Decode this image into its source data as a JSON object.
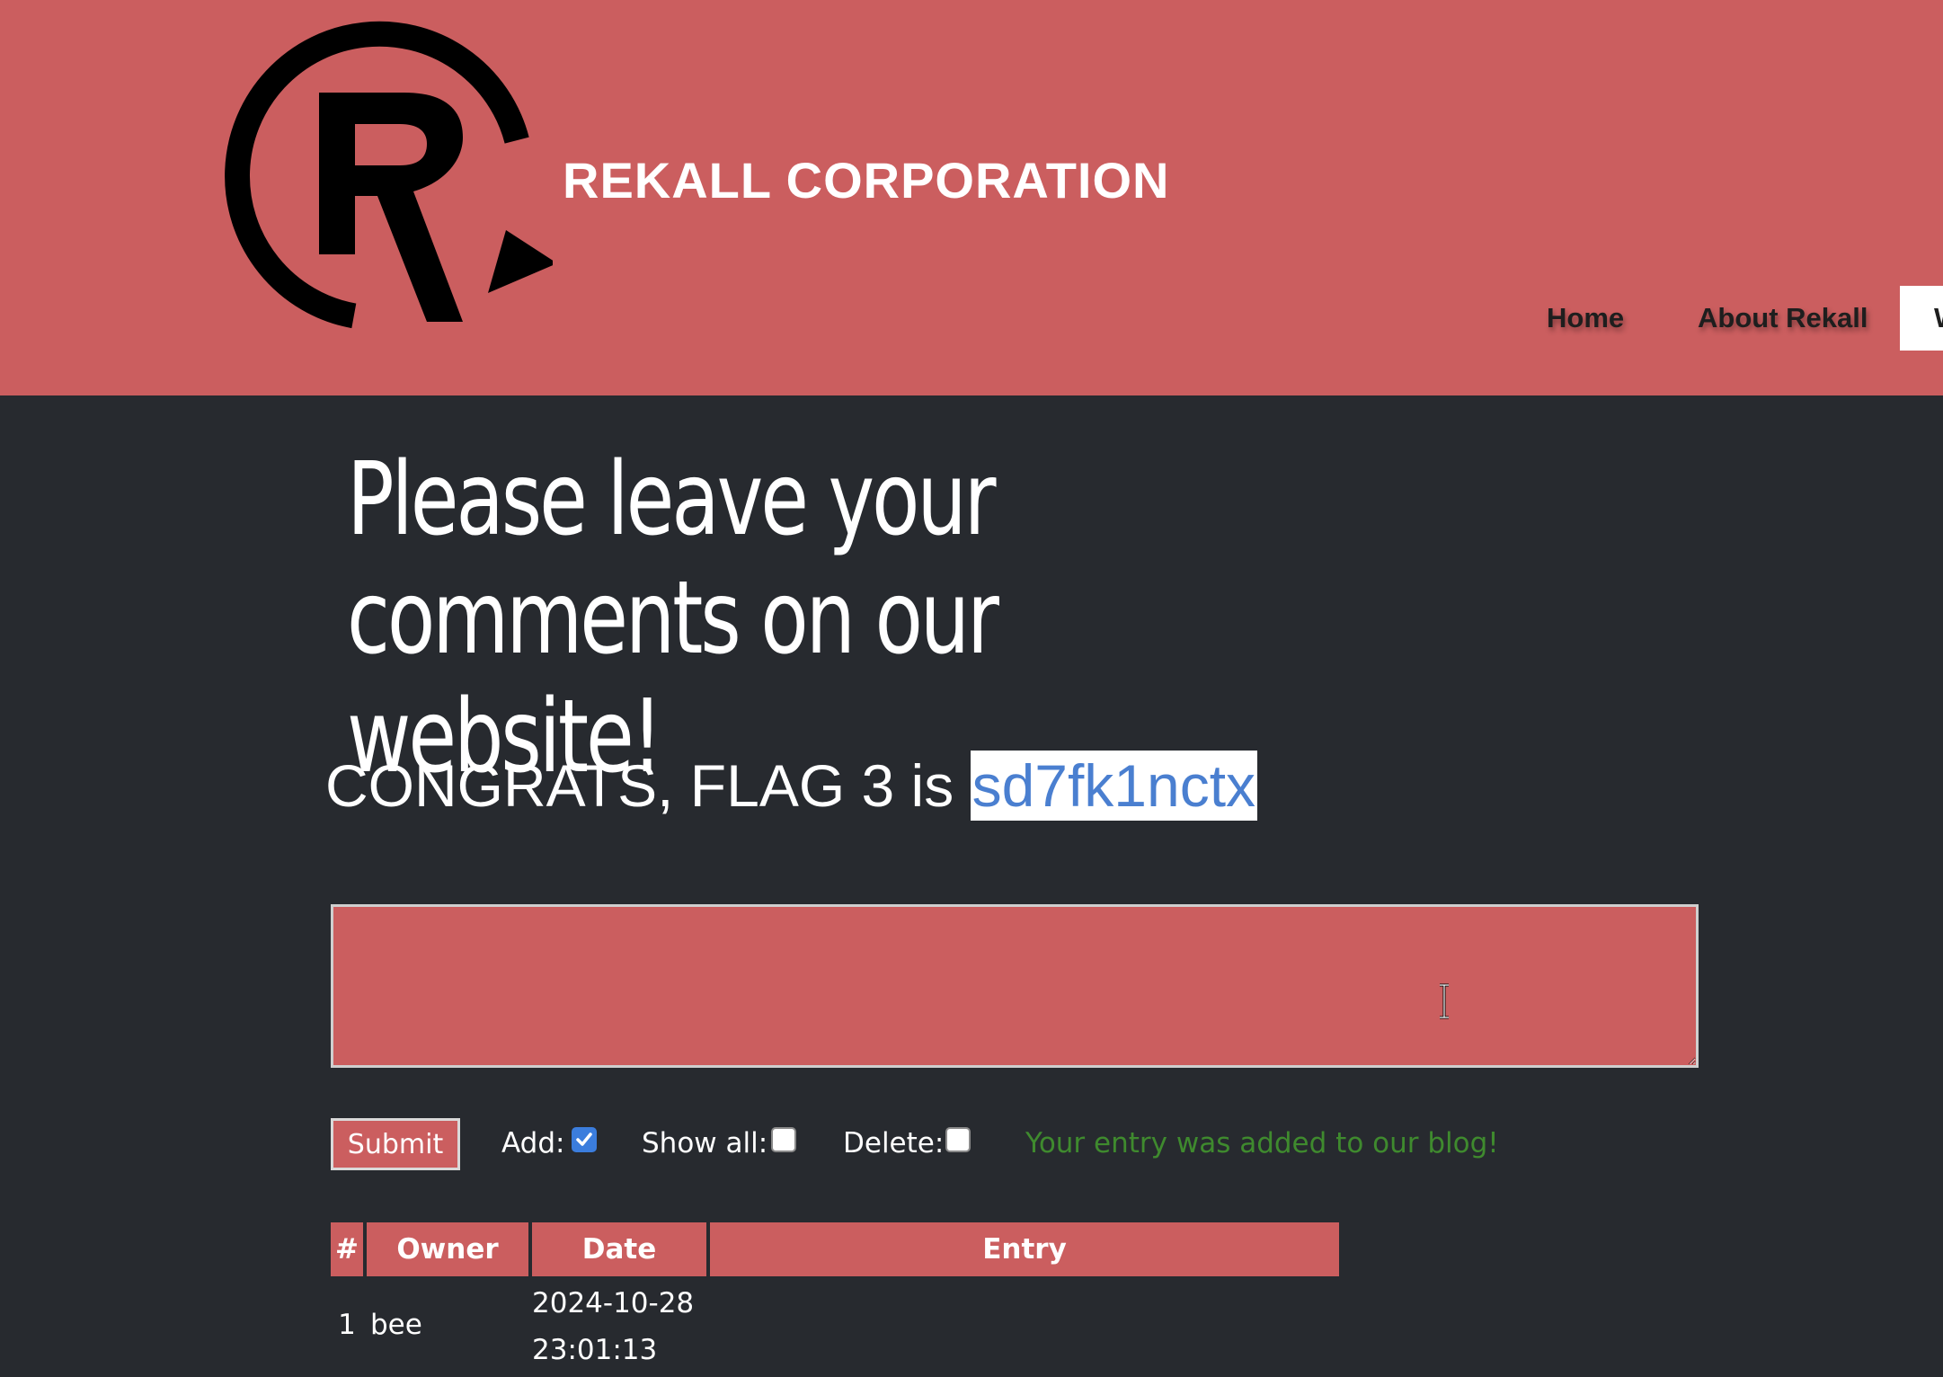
{
  "header": {
    "brand": "REKALL CORPORATION",
    "logo_icon": "rekall-logo-icon",
    "nav": {
      "home": "Home",
      "about": "About Rekall",
      "active_partial": "W"
    },
    "background_color": "#cb5e5f"
  },
  "main": {
    "title": "Please leave your comments on our website!",
    "flag": {
      "prefix": "CONGRATS, FLAG 3 is ",
      "value": "sd7fk1nctx"
    },
    "comment_value": "",
    "controls": {
      "submit_label": "Submit",
      "add_label": "Add:",
      "add_checked": true,
      "show_all_label": "Show all:",
      "show_all_checked": false,
      "delete_label": "Delete:",
      "delete_checked": false,
      "status_message": "Your entry was added to our blog!"
    },
    "table": {
      "headers": [
        "#",
        "Owner",
        "Date",
        "Entry"
      ],
      "rows": [
        {
          "num": "1",
          "owner": "bee",
          "date_line1": "2024-10-28",
          "date_line2": "23:01:13",
          "entry": ""
        }
      ]
    }
  },
  "colors": {
    "accent": "#cb5e5f",
    "page_background": "#272a2f",
    "success_text": "#3f8a2e",
    "flag_text": "#4a7fd0"
  }
}
